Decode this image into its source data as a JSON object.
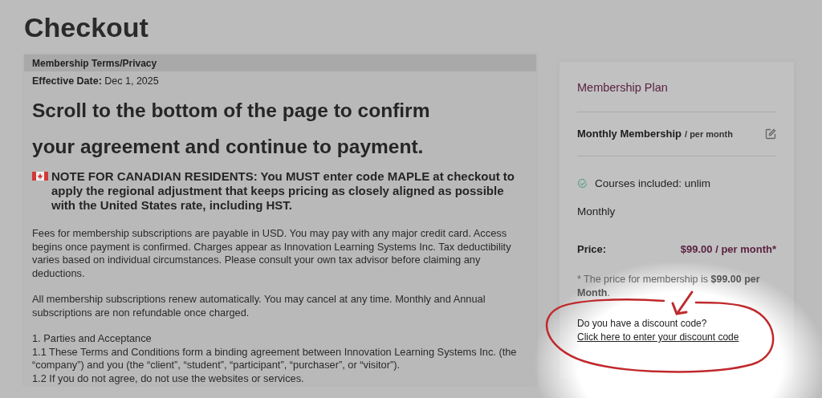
{
  "page": {
    "title": "Checkout"
  },
  "terms": {
    "header": "Membership Terms/Privacy",
    "effective_label": "Effective Date:",
    "effective_date": "Dec 1, 2025",
    "headline": "Scroll to the bottom of the page to confirm your agreement and continue to payment.",
    "notice": "NOTE FOR CANADIAN RESIDENTS: You MUST enter code MAPLE at checkout to apply the regional adjustment that keeps pricing as closely aligned as possible with the United States rate, including HST.",
    "paragraphs": [
      "Fees for membership subscriptions are payable in USD. You may pay with any major credit card. Access begins once payment is confirmed. Charges appear as Innovation Learning Systems Inc. Tax deductibility varies based on individual circumstances. Please consult your own tax advisor before claiming any deductions.",
      "All membership subscriptions renew automatically. You may cancel at any time. Monthly and Annual subscriptions are non refundable once charged."
    ],
    "section_heading": "1. Parties and Acceptance",
    "clauses": [
      "1.1 These Terms and Conditions form a binding agreement between Innovation Learning Systems Inc. (the “company”) and you (the “client”, “student”, “participant”, “purchaser”, or “visitor”).",
      "1.2 If you do not agree, do not use the websites or services."
    ]
  },
  "plan": {
    "title": "Membership Plan",
    "name": "Monthly Membership",
    "period": "/ per month",
    "features": [
      {
        "text": "Courses included: unlim",
        "included": true
      }
    ],
    "billing": "Monthly",
    "price_label": "Price:",
    "price": "$99.00 / per month*",
    "note": "* The price for membership is **$99.00 per Month**.",
    "discount_question": "Do you have a discount code?",
    "discount_link": "Click here to enter your discount code"
  }
}
